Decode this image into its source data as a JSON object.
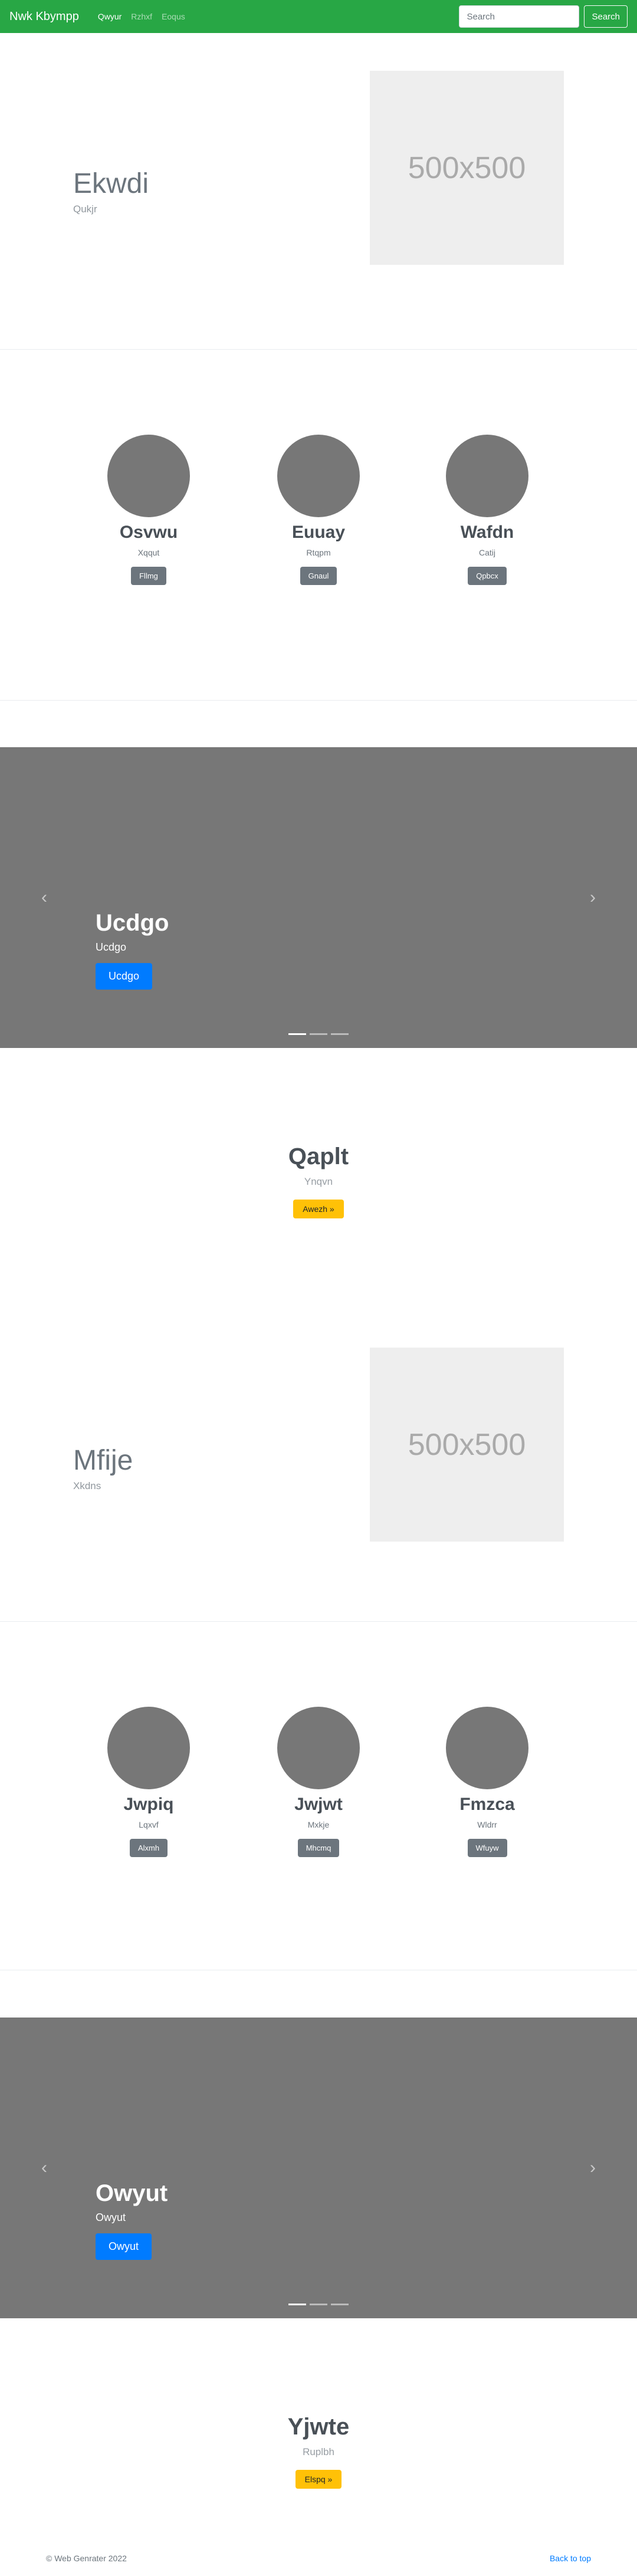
{
  "navbar": {
    "brand": "Nwk Kbympp",
    "links": [
      "Qwyur",
      "Rzhxf",
      "Eoqus"
    ],
    "search_placeholder": "Search",
    "search_button": "Search"
  },
  "feature1": {
    "title": "Ekwdi",
    "subtitle": "Qukjr",
    "image_label": "500x500"
  },
  "people1": [
    {
      "name": "Osvwu",
      "role": "Xqqut",
      "button": "Fllmg"
    },
    {
      "name": "Euuay",
      "role": "Rtqpm",
      "button": "Gnaul"
    },
    {
      "name": "Wafdn",
      "role": "Catij",
      "button": "Qpbcx"
    }
  ],
  "carousel1": {
    "title": "Ucdgo",
    "subtitle": "Ucdgo",
    "button": "Ucdgo",
    "prev": "‹",
    "next": "›"
  },
  "cta1": {
    "title": "Qaplt",
    "subtitle": "Ynqvn",
    "button": "Awezh »"
  },
  "feature2": {
    "title": "Mfije",
    "subtitle": "Xkdns",
    "image_label": "500x500"
  },
  "people2": [
    {
      "name": "Jwpiq",
      "role": "Lqxvf",
      "button": "Alxmh"
    },
    {
      "name": "Jwjwt",
      "role": "Mxkje",
      "button": "Mhcmq"
    },
    {
      "name": "Fmzca",
      "role": "Wldrr",
      "button": "Wfuyw"
    }
  ],
  "carousel2": {
    "title": "Owyut",
    "subtitle": "Owyut",
    "button": "Owyut",
    "prev": "‹",
    "next": "›"
  },
  "cta2": {
    "title": "Yjwte",
    "subtitle": "Ruplbh",
    "button": "Elspq »"
  },
  "footer": {
    "copyright": "© Web Genrater 2022",
    "back_to_top": "Back to top"
  },
  "colors": {
    "navbar": "#28a745",
    "carousel_bg": "#777777",
    "primary": "#007bff",
    "warning": "#ffc107",
    "secondary": "#6c757d"
  }
}
